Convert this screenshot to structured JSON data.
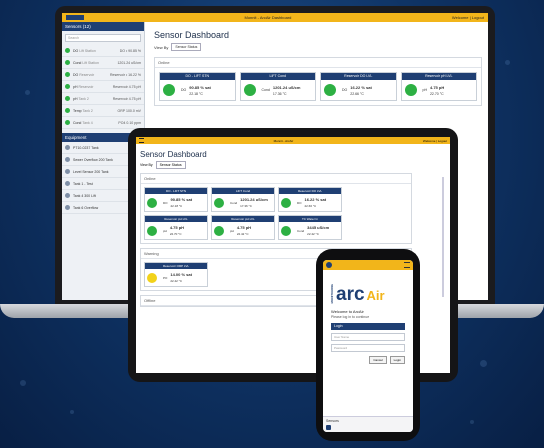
{
  "laptop": {
    "app_title": "Monnit - ArcAir Dashboard",
    "topbar_right": "Welcome  |  Logout",
    "sidebar": {
      "heading": "Sensors",
      "count": "(12)",
      "search_placeholder": "Search",
      "items": [
        {
          "name": "DO",
          "sub": "Lift Station",
          "value": "DO • 90.85 %",
          "status": "green"
        },
        {
          "name": "Cond",
          "sub": "Lift Station",
          "value": "1201.24 uS/cm",
          "status": "green"
        },
        {
          "name": "DO",
          "sub": "Reservoir",
          "value": "Reservoir • 16.22 %",
          "status": "green"
        },
        {
          "name": "pH",
          "sub": "Reservoir",
          "value": "Reservoir 4.75 pH",
          "status": "green"
        },
        {
          "name": "pH",
          "sub": "Tank 2",
          "value": "Reservoir 4.75 pH",
          "status": "green"
        },
        {
          "name": "Temp",
          "sub": "Tank 2",
          "value": "ORP 100.0 mV",
          "status": "green"
        },
        {
          "name": "Cond",
          "sub": "Tank 4",
          "value": "PO4 0.10 ppm",
          "status": "green"
        }
      ],
      "section2_heading": "Equipment",
      "section2_items": [
        "PT10-0237 Tank",
        "Sewer Overflow 200 Tank",
        "Level Sensor 200 Tank",
        "Tank 1 - Test",
        "Tank 4 300 Lift",
        "Tank 6 Overflow"
      ]
    },
    "page_title": "Sensor Dashboard",
    "view_by_label": "View By",
    "view_by_value": "Sensor Status",
    "group_label": "Online",
    "cards": [
      {
        "header": "DO - LIFT STN",
        "reading": "DO",
        "value": "90.85 % sat",
        "temp": "22.18 °C",
        "status": "green"
      },
      {
        "header": "LIFT Cond",
        "reading": "Cond",
        "value": "1201.24 uS/cm",
        "temp": "17.36 °C",
        "status": "green"
      },
      {
        "header": "Reservoir DO LVL",
        "reading": "DO",
        "value": "16.22 % sat",
        "temp": "22.66 °C",
        "status": "green"
      },
      {
        "header": "Reservoir pH LVL",
        "reading": "pH",
        "value": "4.75 pH",
        "temp": "22.70 °C",
        "status": "green"
      }
    ]
  },
  "tablet": {
    "app_title": "Monnit - ArcAir",
    "topbar_right": "Welcome  |  Logout",
    "page_title": "Sensor Dashboard",
    "view_by_label": "View By",
    "view_by_value": "Sensor Status",
    "group_label": "Online",
    "cards": [
      {
        "header": "DO - LIFT STN",
        "reading": "DO",
        "value": "90.85 % sat",
        "temp": "22.18 °C",
        "status": "green"
      },
      {
        "header": "LIFT Cond",
        "reading": "Cond",
        "value": "1201.24 uS/cm",
        "temp": "17.36 °C",
        "status": "green"
      },
      {
        "header": "Reservoir DO LVL",
        "reading": "DO",
        "value": "16.22 % sat",
        "temp": "22.66 °C",
        "status": "green"
      },
      {
        "header": "Reservoir pH LVL",
        "reading": "pH",
        "value": "4.75 pH",
        "temp": "22.70 °C",
        "status": "green"
      },
      {
        "header": "Reservoir pH LVL",
        "reading": "pH",
        "value": "4.75 pH",
        "temp": "22.42 °C",
        "status": "green"
      },
      {
        "header": "TC Water In",
        "reading": "Cond",
        "value": "3445 uS/cm",
        "temp": "22.42 °C",
        "status": "green"
      }
    ],
    "group2_label": "Warning",
    "warning_card": {
      "header": "Reservoir ORP LVL",
      "reading": "PO",
      "value": "14.00 % sat",
      "temp": "22.42 °C",
      "status": "yellow"
    },
    "group3_label": "Offline"
  },
  "phone": {
    "brand_small": "MONITORING",
    "brand_arc": "arc",
    "brand_air": "Air",
    "welcome": "Welcome to ArcAir",
    "subtitle": "Please log in to continue",
    "login_heading": "Login",
    "username_placeholder": "User Name",
    "password_placeholder": "Password",
    "cancel_label": "Cancel",
    "login_label": "Login",
    "footer_label": "Sensors"
  },
  "colors": {
    "brand_blue": "#1f3f73",
    "accent_yellow": "#f2b51a",
    "ok_green": "#2db043",
    "warn_yellow": "#f2d21a"
  }
}
